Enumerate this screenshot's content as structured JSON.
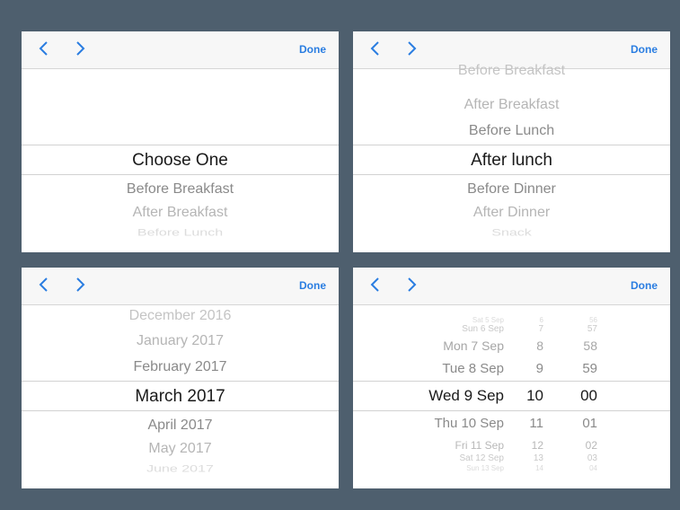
{
  "toolbar": {
    "prev_icon": "chevron-left-icon",
    "next_icon": "chevron-right-icon",
    "done_label": "Done",
    "accent_color": "#2a7de1"
  },
  "background_color": "#4e5f6e",
  "picker1": {
    "items": [
      "Choose One",
      "Before Breakfast",
      "After Breakfast",
      "Before Lunch"
    ],
    "selected": "Choose One"
  },
  "picker2": {
    "items": [
      "Before Breakfast",
      "After Breakfast",
      "Before Lunch",
      "After lunch",
      "Before Dinner",
      "After Dinner",
      "Snack"
    ],
    "selected": "After lunch"
  },
  "picker3": {
    "items": [
      "December 2016",
      "January 2017",
      "February 2017",
      "March 2017",
      "April 2017",
      "May 2017",
      "June 2017"
    ],
    "selected": "March 2017"
  },
  "picker4": {
    "dates": [
      "Sat 5 Sep",
      "Sun 6 Sep",
      "Mon 7 Sep",
      "Tue 8 Sep",
      "Wed 9 Sep",
      "Thu 10 Sep",
      "Fri 11 Sep",
      "Sat 12 Sep",
      "Sun 13 Sep"
    ],
    "hours": [
      "6",
      "7",
      "8",
      "9",
      "10",
      "11",
      "12",
      "13",
      "14"
    ],
    "minutes": [
      "56",
      "57",
      "58",
      "59",
      "00",
      "01",
      "02",
      "03",
      "04"
    ],
    "selected": {
      "date": "Wed 9 Sep",
      "hour": "10",
      "minute": "00"
    }
  }
}
